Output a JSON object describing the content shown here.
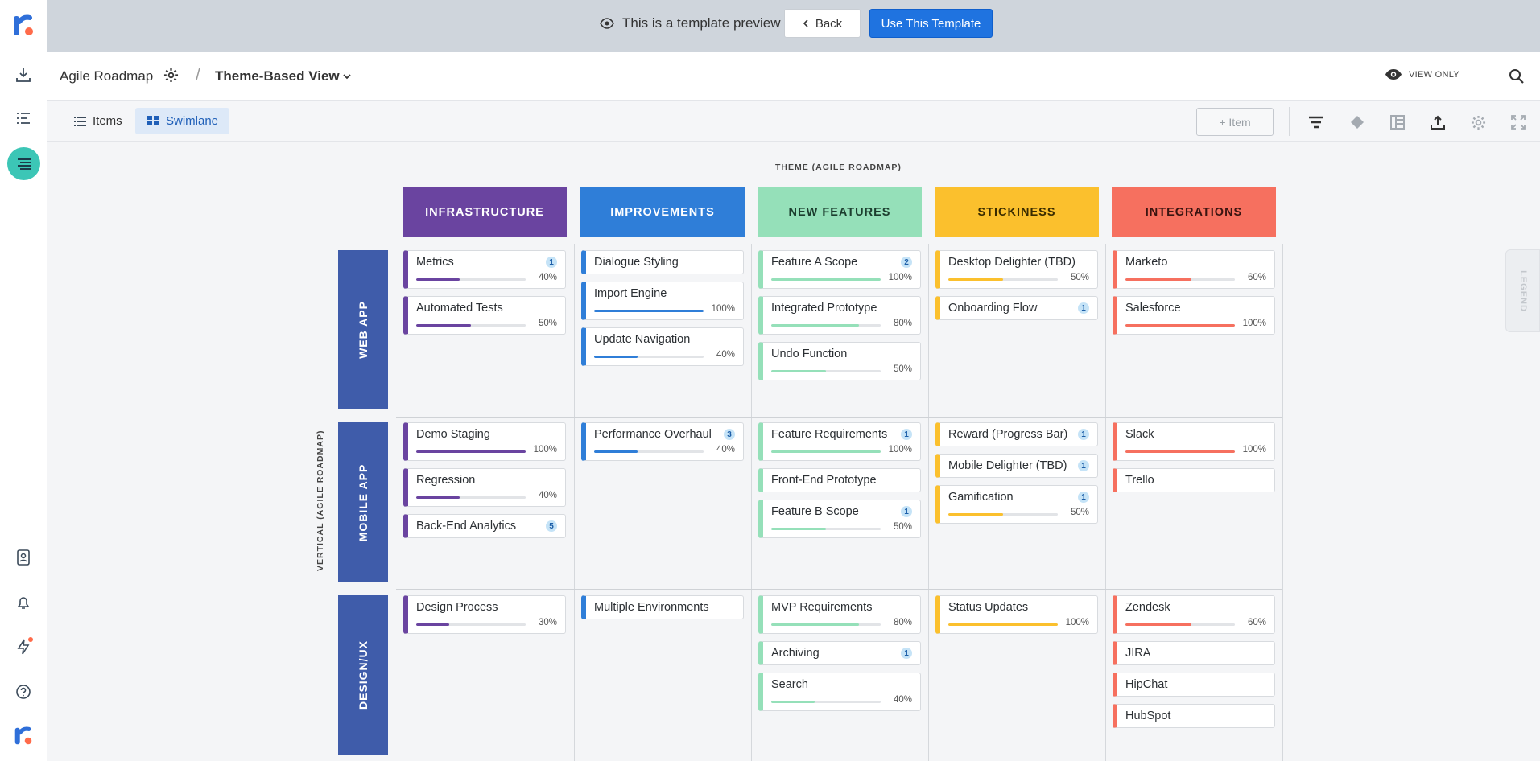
{
  "preview_bar": {
    "message": "This is a template preview",
    "back_label": "Back",
    "use_label": "Use This Template"
  },
  "header": {
    "roadmap_name": "Agile Roadmap",
    "view_name": "Theme-Based View",
    "view_only": "VIEW ONLY"
  },
  "toolbar": {
    "tab_items": "Items",
    "tab_swimlane": "Swimlane",
    "add_item": "+ Item"
  },
  "board": {
    "theme_axis_label": "THEME (AGILE ROADMAP)",
    "vertical_axis_label": "VERTICAL (AGILE ROADMAP)",
    "columns": [
      {
        "label": "INFRASTRUCTURE",
        "color": "#6a44a0"
      },
      {
        "label": "IMPROVEMENTS",
        "color": "#2f7ed8"
      },
      {
        "label": "NEW FEATURES",
        "color": "#95e0b9"
      },
      {
        "label": "STICKINESS",
        "color": "#fbc02d"
      },
      {
        "label": "INTEGRATIONS",
        "color": "#f6705f"
      }
    ],
    "rows": [
      {
        "label": "WEB APP"
      },
      {
        "label": "MOBILE APP"
      },
      {
        "label": "DESIGN/UX"
      }
    ],
    "cells": [
      [
        [
          {
            "title": "Metrics",
            "badge": "1",
            "progress": 40,
            "pct": "40%"
          },
          {
            "title": "Automated Tests",
            "progress": 50,
            "pct": "50%"
          }
        ],
        [
          {
            "title": "Dialogue Styling"
          },
          {
            "title": "Import Engine",
            "progress": 100,
            "pct": "100%"
          },
          {
            "title": "Update Navigation",
            "progress": 40,
            "pct": "40%"
          }
        ],
        [
          {
            "title": "Feature A Scope",
            "badge": "2",
            "progress": 100,
            "pct": "100%"
          },
          {
            "title": "Integrated Prototype",
            "progress": 80,
            "pct": "80%"
          },
          {
            "title": "Undo Function",
            "progress": 50,
            "pct": "50%"
          }
        ],
        [
          {
            "title": "Desktop Delighter (TBD)",
            "progress": 50,
            "pct": "50%"
          },
          {
            "title": "Onboarding Flow",
            "badge": "1"
          }
        ],
        [
          {
            "title": "Marketo",
            "progress": 60,
            "pct": "60%"
          },
          {
            "title": "Salesforce",
            "progress": 100,
            "pct": "100%"
          }
        ]
      ],
      [
        [
          {
            "title": "Demo Staging",
            "progress": 100,
            "pct": "100%"
          },
          {
            "title": "Regression",
            "progress": 40,
            "pct": "40%"
          },
          {
            "title": "Back-End Analytics",
            "badge": "5"
          }
        ],
        [
          {
            "title": "Performance Overhaul",
            "badge": "3",
            "progress": 40,
            "pct": "40%"
          }
        ],
        [
          {
            "title": "Feature Requirements",
            "badge": "1",
            "progress": 100,
            "pct": "100%"
          },
          {
            "title": "Front-End Prototype"
          },
          {
            "title": "Feature B Scope",
            "badge": "1",
            "progress": 50,
            "pct": "50%"
          }
        ],
        [
          {
            "title": "Reward (Progress Bar)",
            "badge": "1"
          },
          {
            "title": "Mobile Delighter (TBD)",
            "badge": "1"
          },
          {
            "title": "Gamification",
            "badge": "1",
            "progress": 50,
            "pct": "50%"
          }
        ],
        [
          {
            "title": "Slack",
            "progress": 100,
            "pct": "100%"
          },
          {
            "title": "Trello"
          }
        ]
      ],
      [
        [
          {
            "title": "Design Process",
            "progress": 30,
            "pct": "30%"
          }
        ],
        [
          {
            "title": "Multiple Environments"
          }
        ],
        [
          {
            "title": "MVP Requirements",
            "progress": 80,
            "pct": "80%"
          },
          {
            "title": "Archiving",
            "badge": "1"
          },
          {
            "title": "Search",
            "progress": 40,
            "pct": "40%"
          }
        ],
        [
          {
            "title": "Status Updates",
            "progress": 100,
            "pct": "100%"
          }
        ],
        [
          {
            "title": "Zendesk",
            "progress": 60,
            "pct": "60%"
          },
          {
            "title": "JIRA"
          },
          {
            "title": "HipChat"
          },
          {
            "title": "HubSpot"
          }
        ]
      ]
    ],
    "legend": "LEGEND"
  }
}
